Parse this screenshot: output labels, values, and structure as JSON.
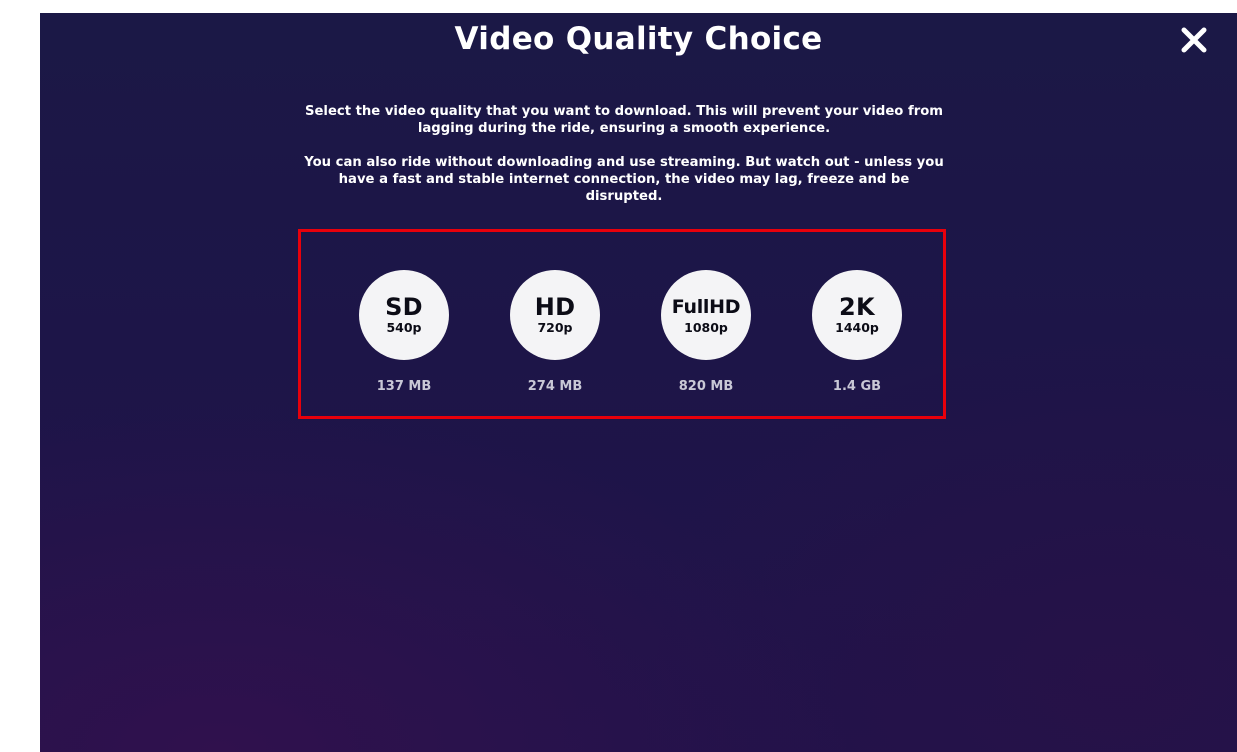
{
  "dialog": {
    "title": "Video Quality Choice",
    "close_icon": "close-icon"
  },
  "description": {
    "paragraph_1": "Select the video quality that you want to download. This will prevent your video from lagging during the ride, ensuring a smooth experience.",
    "paragraph_2": "You can also ride without downloading and use streaming. But watch out - unless you have a fast and stable internet connection, the video may lag, freeze and be disrupted."
  },
  "options": [
    {
      "name": "SD",
      "resolution": "540p",
      "size": "137 MB"
    },
    {
      "name": "HD",
      "resolution": "720p",
      "size": "274 MB"
    },
    {
      "name": "FullHD",
      "resolution": "1080p",
      "size": "820 MB"
    },
    {
      "name": "2K",
      "resolution": "1440p",
      "size": "1.4 GB"
    }
  ],
  "colors": {
    "background": "#1d1548",
    "highlight_border": "#e8000b",
    "circle_fill": "#f4f4f6",
    "text": "#ffffff",
    "size_text": "#c9c8d6"
  }
}
